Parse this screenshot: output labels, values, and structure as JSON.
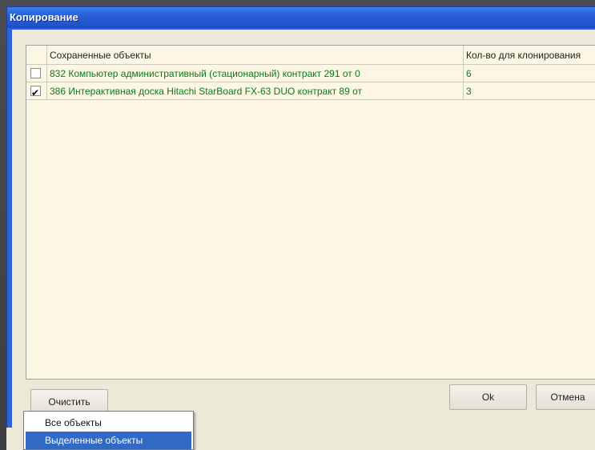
{
  "window": {
    "title": "Копирование"
  },
  "grid": {
    "columns": [
      "",
      "Сохраненные объекты",
      "Кол-во для клонирования"
    ],
    "rows": [
      {
        "checked": false,
        "name": "832 Компьютер административный (стационарный) контракт 291 от 0",
        "count": "6"
      },
      {
        "checked": true,
        "name": "386 Интерактивная доска Hitachi StarBoard FX-63 DUO контракт 89 от",
        "count": "3"
      }
    ]
  },
  "buttons": {
    "clear": "Очистить",
    "ok": "Ok",
    "cancel": "Отмена"
  },
  "menu": {
    "items": [
      "Все объекты",
      "Выделенные объекты"
    ],
    "selected_index": 1
  },
  "colors": {
    "accent": "#316ac5",
    "titlebar": "#2a5fd8",
    "row_text": "#0b7a17"
  }
}
